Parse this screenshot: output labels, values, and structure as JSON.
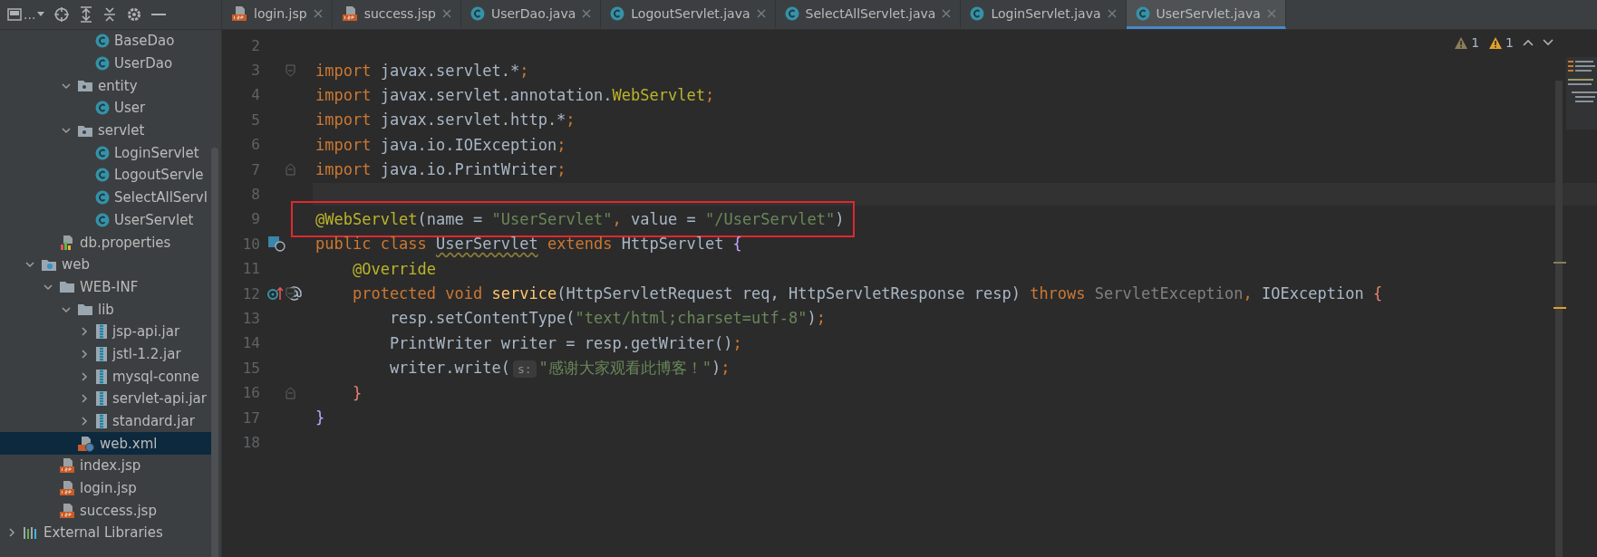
{
  "toolbar": {
    "title": "..."
  },
  "tabs": [
    {
      "label": "login.jsp",
      "kind": "jsp",
      "selected": false
    },
    {
      "label": "success.jsp",
      "kind": "jsp",
      "selected": false
    },
    {
      "label": "UserDao.java",
      "kind": "class",
      "selected": false
    },
    {
      "label": "LogoutServlet.java",
      "kind": "class",
      "selected": false
    },
    {
      "label": "SelectAllServlet.java",
      "kind": "class",
      "selected": false
    },
    {
      "label": "LoginServlet.java",
      "kind": "class",
      "selected": false
    },
    {
      "label": "UserServlet.java",
      "kind": "class",
      "selected": true
    }
  ],
  "project_tree": [
    {
      "children": [
        {
          "children": [
            {
              "children": [
                {
                  "children": [
                    {
                      "label": "BaseDao",
                      "kind": "class",
                      "selected": false
                    },
                    {
                      "label": "UserDao",
                      "kind": "class",
                      "selected": false
                    }
                  ]
                },
                {
                  "label": "entity",
                  "kind": "package",
                  "expanded": true,
                  "selected": false,
                  "children": [
                    {
                      "label": "User",
                      "kind": "class",
                      "selected": false
                    }
                  ]
                },
                {
                  "label": "servlet",
                  "kind": "package",
                  "expanded": true,
                  "selected": false,
                  "children": [
                    {
                      "label": "LoginServlet",
                      "kind": "class",
                      "selected": false
                    },
                    {
                      "label": "LogoutServle",
                      "kind": "class",
                      "selected": false
                    },
                    {
                      "label": "SelectAllServl",
                      "kind": "class",
                      "selected": false
                    },
                    {
                      "label": "UserServlet",
                      "kind": "class",
                      "selected": false
                    }
                  ]
                }
              ]
            },
            {
              "label": "db.properties",
              "kind": "properties",
              "selected": false
            }
          ]
        },
        {
          "label": "web",
          "kind": "webfolder",
          "expanded": true,
          "selected": false,
          "children": [
            {
              "label": "WEB-INF",
              "kind": "folder",
              "expanded": true,
              "selected": false,
              "children": [
                {
                  "label": "lib",
                  "kind": "folder",
                  "expanded": true,
                  "selected": false,
                  "children": [
                    {
                      "label": "jsp-api.jar",
                      "kind": "jar",
                      "expanded": false,
                      "selected": false
                    },
                    {
                      "label": "jstl-1.2.jar",
                      "kind": "jar",
                      "expanded": false,
                      "selected": false
                    },
                    {
                      "label": "mysql-conne",
                      "kind": "jar",
                      "expanded": false,
                      "selected": false
                    },
                    {
                      "label": "servlet-api.jar",
                      "kind": "jar",
                      "expanded": false,
                      "selected": false
                    },
                    {
                      "label": "standard.jar",
                      "kind": "jar",
                      "expanded": false,
                      "selected": false
                    }
                  ]
                },
                {
                  "label": "web.xml",
                  "kind": "xml",
                  "selected": true
                }
              ]
            },
            {
              "label": "index.jsp",
              "kind": "jsp",
              "selected": false
            },
            {
              "label": "login.jsp",
              "kind": "jsp",
              "selected": false
            },
            {
              "label": "success.jsp",
              "kind": "jsp",
              "selected": false
            }
          ]
        }
      ]
    },
    {
      "label": "External Libraries",
      "kind": "libraries",
      "expanded": false,
      "selected": false
    }
  ],
  "inspections": [
    {
      "kind": "weak",
      "count": "1"
    },
    {
      "kind": "warning",
      "count": "1"
    }
  ],
  "code_lines": [
    {
      "number": "2"
    },
    {
      "number": "3",
      "fold_start": true,
      "tokens": [
        {
          "kind": "keyword",
          "text": "import"
        },
        {
          "kind": "plain",
          "text": " javax.servlet.*"
        },
        {
          "kind": "keyword",
          "text": ";"
        }
      ]
    },
    {
      "number": "4",
      "tokens": [
        {
          "kind": "keyword",
          "text": "import"
        },
        {
          "kind": "plain",
          "text": " javax.servlet.annotation."
        },
        {
          "kind": "annotation",
          "text": "WebServlet"
        },
        {
          "kind": "keyword",
          "text": ";"
        }
      ]
    },
    {
      "number": "5",
      "tokens": [
        {
          "kind": "keyword",
          "text": "import"
        },
        {
          "kind": "plain",
          "text": " javax.servlet.http.*"
        },
        {
          "kind": "keyword",
          "text": ";"
        }
      ]
    },
    {
      "number": "6",
      "tokens": [
        {
          "kind": "keyword",
          "text": "import"
        },
        {
          "kind": "plain",
          "text": " java.io.IOException"
        },
        {
          "kind": "keyword",
          "text": ";"
        }
      ]
    },
    {
      "number": "7",
      "fold_end": true,
      "tokens": [
        {
          "kind": "keyword",
          "text": "import"
        },
        {
          "kind": "plain",
          "text": " java.io.PrintWriter"
        },
        {
          "kind": "keyword",
          "text": ";"
        }
      ]
    },
    {
      "number": "8",
      "current": true
    },
    {
      "number": "9",
      "boxed": true,
      "tokens": [
        {
          "kind": "annotation",
          "text": "@WebServlet"
        },
        {
          "kind": "paren",
          "text": "("
        },
        {
          "kind": "plain",
          "text": "name = "
        },
        {
          "kind": "string",
          "text": "\"UserServlet\""
        },
        {
          "kind": "keyword",
          "text": ","
        },
        {
          "kind": "plain",
          "text": " value = "
        },
        {
          "kind": "string",
          "text": "\"/UserServlet\""
        },
        {
          "kind": "paren",
          "text": ")"
        }
      ]
    },
    {
      "number": "10",
      "servlet_mark": true,
      "tokens": [
        {
          "kind": "keyword",
          "text": "public class "
        },
        {
          "kind": "warned",
          "text": "UserServlet"
        },
        {
          "kind": "keyword",
          "text": " extends "
        },
        {
          "kind": "plain",
          "text": "HttpServlet "
        },
        {
          "kind": "brace",
          "text": "{"
        }
      ]
    },
    {
      "number": "11",
      "tokens": [
        {
          "kind": "annotation",
          "text": "    @Override"
        }
      ]
    },
    {
      "number": "12",
      "override_mark": true,
      "fold_start": true,
      "tokens": [
        {
          "kind": "keyword",
          "text": "    protected void "
        },
        {
          "kind": "method",
          "text": "service"
        },
        {
          "kind": "paren",
          "text": "("
        },
        {
          "kind": "plain",
          "text": "HttpServletRequest req, HttpServletResponse resp"
        },
        {
          "kind": "paren",
          "text": ")"
        },
        {
          "kind": "keyword",
          "text": " throws "
        },
        {
          "kind": "dim",
          "text": "ServletException"
        },
        {
          "kind": "keyword",
          "text": ", "
        },
        {
          "kind": "plain",
          "text": "IOException "
        },
        {
          "kind": "brace2",
          "text": "{"
        }
      ]
    },
    {
      "number": "13",
      "tokens": [
        {
          "kind": "plain",
          "text": "        resp.setContentType"
        },
        {
          "kind": "paren",
          "text": "("
        },
        {
          "kind": "string",
          "text": "\"text/html;charset=utf-8\""
        },
        {
          "kind": "paren",
          "text": ")"
        },
        {
          "kind": "keyword",
          "text": ";"
        }
      ]
    },
    {
      "number": "14",
      "tokens": [
        {
          "kind": "plain",
          "text": "        PrintWriter writer = resp.getWriter"
        },
        {
          "kind": "paren",
          "text": "()"
        },
        {
          "kind": "keyword",
          "text": ";"
        }
      ]
    },
    {
      "number": "15",
      "tokens": [
        {
          "kind": "plain",
          "text": "        writer.write"
        },
        {
          "kind": "paren",
          "text": "("
        },
        {
          "kind": "hint",
          "text": "s:"
        },
        {
          "kind": "string",
          "text": "\"感谢大家观看此博客！\""
        },
        {
          "kind": "paren",
          "text": ")"
        },
        {
          "kind": "keyword",
          "text": ";"
        }
      ]
    },
    {
      "number": "16",
      "fold_end": true,
      "tokens": [
        {
          "kind": "brace2",
          "text": "    }"
        }
      ]
    },
    {
      "number": "17",
      "tokens": [
        {
          "kind": "brace",
          "text": "}"
        }
      ]
    },
    {
      "number": "18"
    }
  ]
}
